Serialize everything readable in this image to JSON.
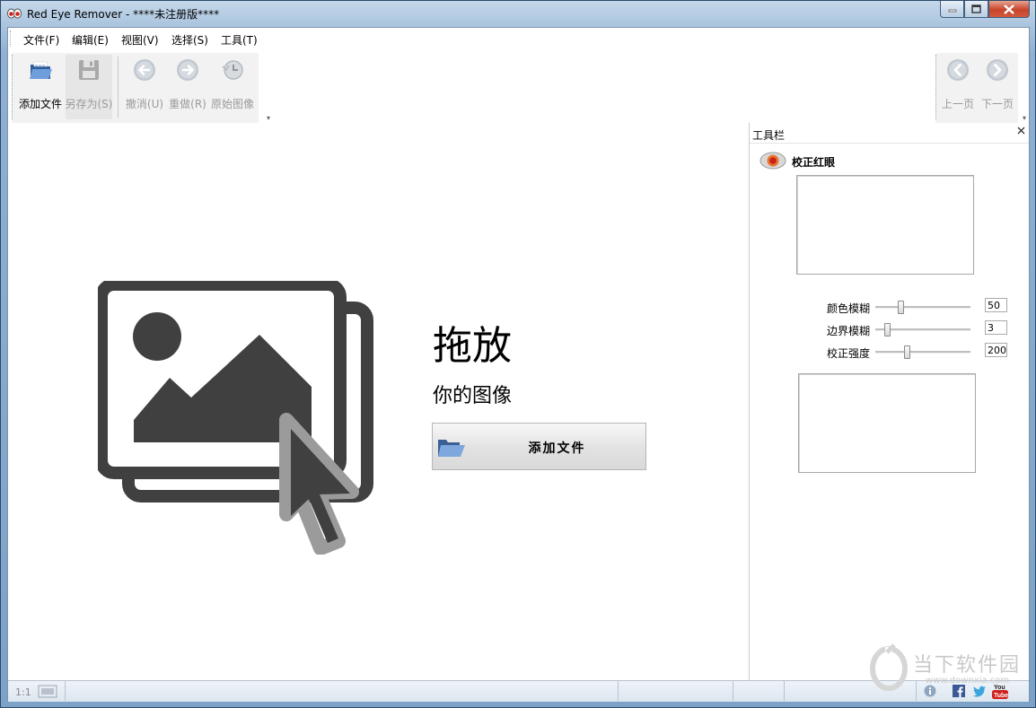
{
  "window": {
    "title": "Red Eye Remover - ****未注册版****"
  },
  "menu": [
    {
      "label": "文件(F)"
    },
    {
      "label": "编辑(E)"
    },
    {
      "label": "视图(V)"
    },
    {
      "label": "选择(S)"
    },
    {
      "label": "工具(T)"
    }
  ],
  "toolbar": {
    "add_file": "添加文件",
    "save_as": "另存为(S)",
    "undo": "撤消(U)",
    "redo": "重做(R)",
    "original": "原始图像",
    "prev_page": "上一页",
    "next_page": "下一页"
  },
  "drop": {
    "heading": "拖放",
    "subheading": "你的图像",
    "button_label": "添加文件"
  },
  "panel": {
    "title": "工具栏",
    "section": "校正红眼",
    "sliders": [
      {
        "label": "颜色模糊",
        "value": "50",
        "level": 0.25
      },
      {
        "label": "边界模糊",
        "value": "3",
        "level": 0.12
      },
      {
        "label": "校正强度",
        "value": "200",
        "level": 0.33
      }
    ]
  },
  "status": {
    "zoom": "1:1"
  },
  "watermark": {
    "text": "当下软件园",
    "url": "www.downxia.com"
  },
  "colors": {
    "icon_dark": "#404040",
    "accent_blue": "#4a78b8",
    "close_red": "#c7452b"
  }
}
